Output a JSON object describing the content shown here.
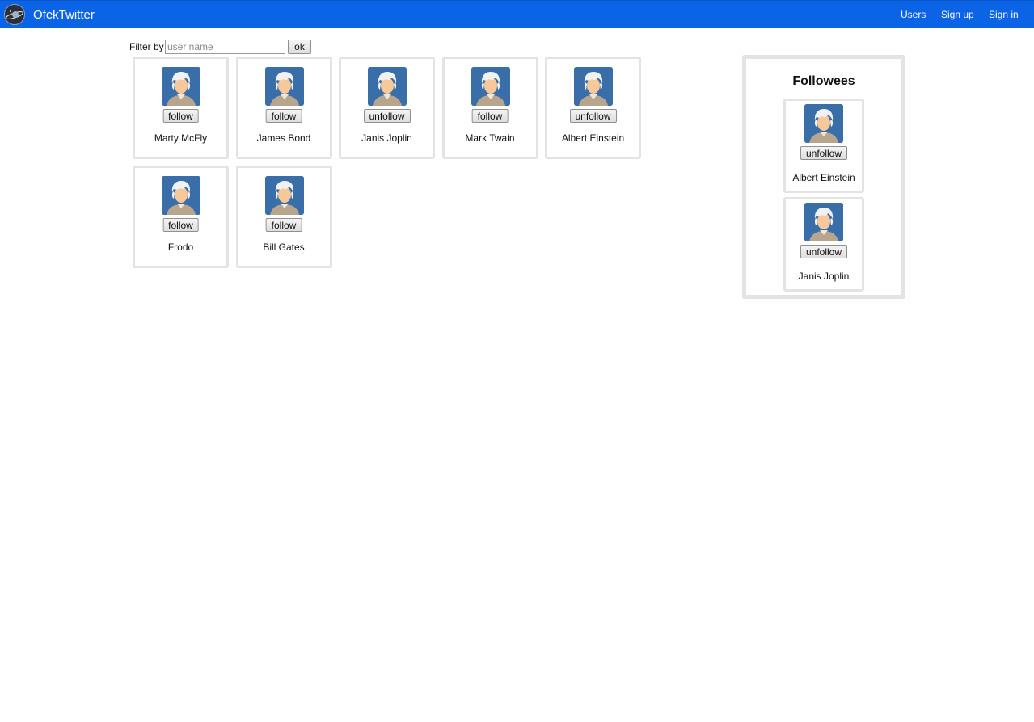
{
  "app": {
    "title": "OfekTwitter",
    "nav": [
      "Users",
      "Sign up",
      "Sign in"
    ]
  },
  "filter": {
    "label": "Filter by",
    "placeholder": "user name",
    "ok_label": "ok"
  },
  "users": [
    {
      "name": "Marty McFly",
      "action": "follow"
    },
    {
      "name": "James Bond",
      "action": "follow"
    },
    {
      "name": "Janis Joplin",
      "action": "unfollow"
    },
    {
      "name": "Mark Twain",
      "action": "follow"
    },
    {
      "name": "Albert Einstein",
      "action": "unfollow"
    },
    {
      "name": "Frodo",
      "action": "follow"
    },
    {
      "name": "Bill Gates",
      "action": "follow"
    }
  ],
  "followees": {
    "title": "Followees",
    "items": [
      {
        "name": "Albert Einstein",
        "action": "unfollow"
      },
      {
        "name": "Janis Joplin",
        "action": "unfollow"
      }
    ]
  },
  "colors": {
    "navbar": "#0b63e5",
    "avatar_bg": "#3a6ea8",
    "card_border": "#e3e3e3"
  },
  "icons": {
    "brand": "planet-logo-icon",
    "avatar": "user-avatar-icon"
  }
}
